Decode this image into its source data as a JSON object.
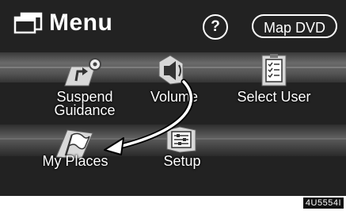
{
  "header": {
    "title": "Menu",
    "help_label": "?",
    "map_dvd_label": "Map DVD"
  },
  "items": {
    "suspend_guidance": {
      "line1": "Suspend",
      "line2": "Guidance"
    },
    "volume": {
      "label": "Volume"
    },
    "select_user": {
      "label": "Select User"
    },
    "my_places": {
      "label": "My Places"
    },
    "setup": {
      "label": "Setup"
    }
  },
  "footer": {
    "code": "4U5554I"
  },
  "icons": {
    "menu": "menu-windows-icon",
    "suspend_guidance": "route-arrow-icon",
    "volume": "speaker-icon",
    "select_user": "clipboard-checklist-icon",
    "my_places": "flag-icon",
    "setup": "settings-sliders-icon"
  },
  "colors": {
    "background": "#222222",
    "band": "#5a5a5a",
    "text": "#ffffff"
  }
}
